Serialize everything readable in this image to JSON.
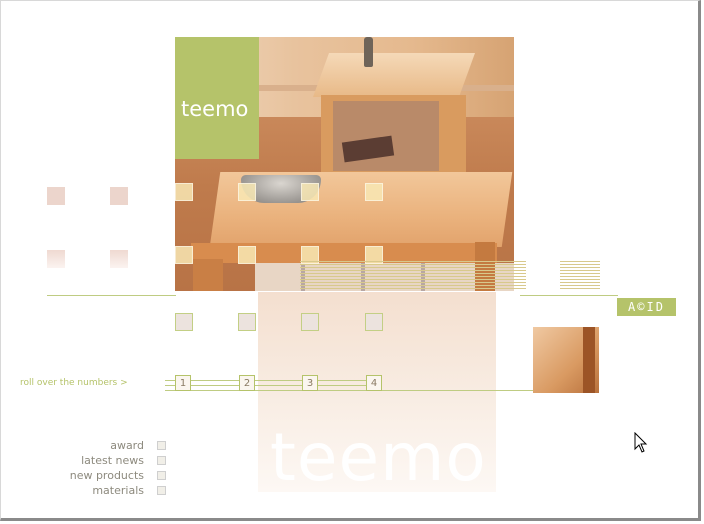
{
  "brand": {
    "name": "teemo",
    "reflection_text": "teemo"
  },
  "logo": {
    "text": "A©ID"
  },
  "rollover": {
    "hint": "roll over the numbers >",
    "numbers": [
      "1",
      "2",
      "3",
      "4"
    ]
  },
  "menu": {
    "items": [
      {
        "label": "award"
      },
      {
        "label": "latest news"
      },
      {
        "label": "new products"
      },
      {
        "label": "materials"
      }
    ]
  },
  "colors": {
    "accent": "#b5c36a",
    "menu_text": "#8d8a7e",
    "frame": "#8a8a8a"
  }
}
